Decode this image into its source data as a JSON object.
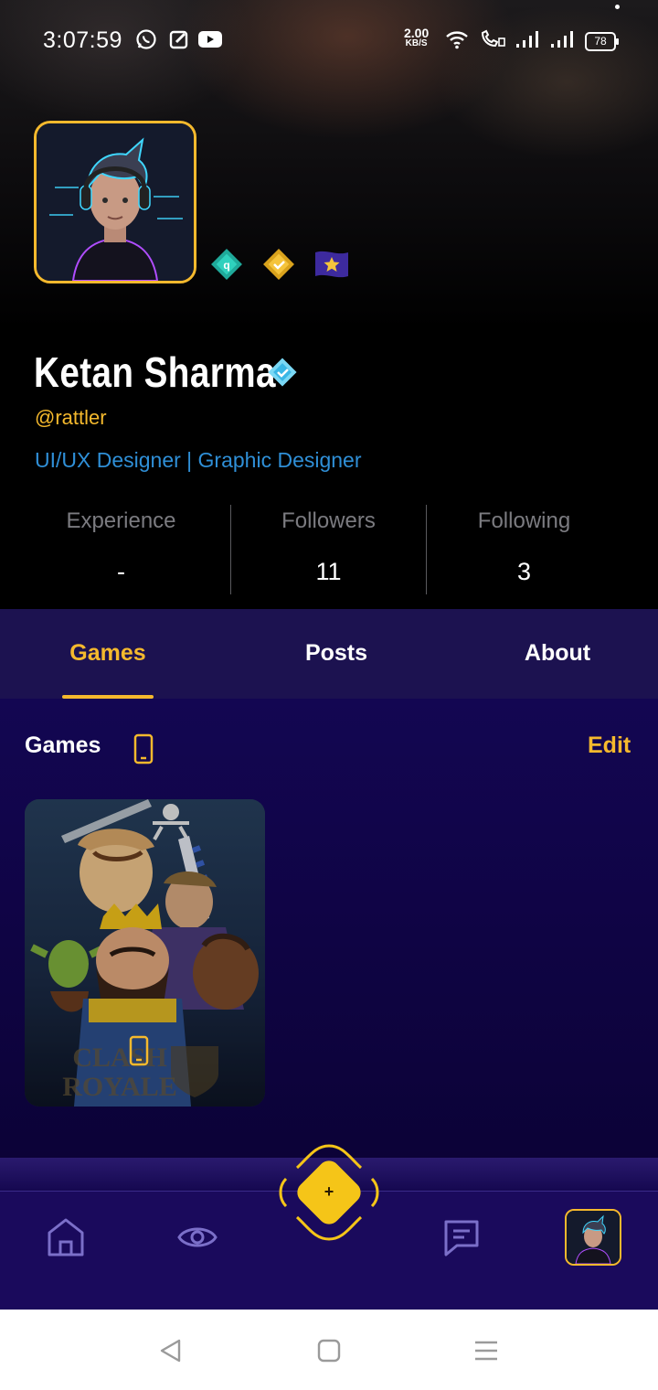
{
  "status_bar": {
    "time": "3:07:59",
    "speed_value": "2.00",
    "speed_unit": "KB/S",
    "battery": "78"
  },
  "profile": {
    "name": "Ketan Sharma",
    "handle": "@rattler",
    "bio": "UI/UX Designer | Graphic Designer",
    "badges": [
      "teal-rank-badge-icon",
      "gold-check-badge-icon",
      "purple-flag-badge-icon"
    ]
  },
  "stats": [
    {
      "label": "Experience",
      "value": "-"
    },
    {
      "label": "Followers",
      "value": "11"
    },
    {
      "label": "Following",
      "value": "3"
    }
  ],
  "tabs": [
    {
      "label": "Games",
      "active": true
    },
    {
      "label": "Posts",
      "active": false
    },
    {
      "label": "About",
      "active": false
    }
  ],
  "games_section": {
    "title": "Games",
    "edit_label": "Edit",
    "games": [
      {
        "title_line1": "CLASH",
        "title_line2": "ROYALE",
        "platform": "mobile"
      }
    ]
  },
  "bottom_nav": {
    "fab_label": "+",
    "items": [
      "home-icon",
      "eye-icon",
      "create-fab",
      "chat-icon",
      "profile-avatar"
    ]
  },
  "colors": {
    "accent": "#f5b92d",
    "bio": "#2f8fd7",
    "tabs_bg": "#1c1250",
    "content_bg": "#130652",
    "nav_bg": "#1a0a5c"
  }
}
